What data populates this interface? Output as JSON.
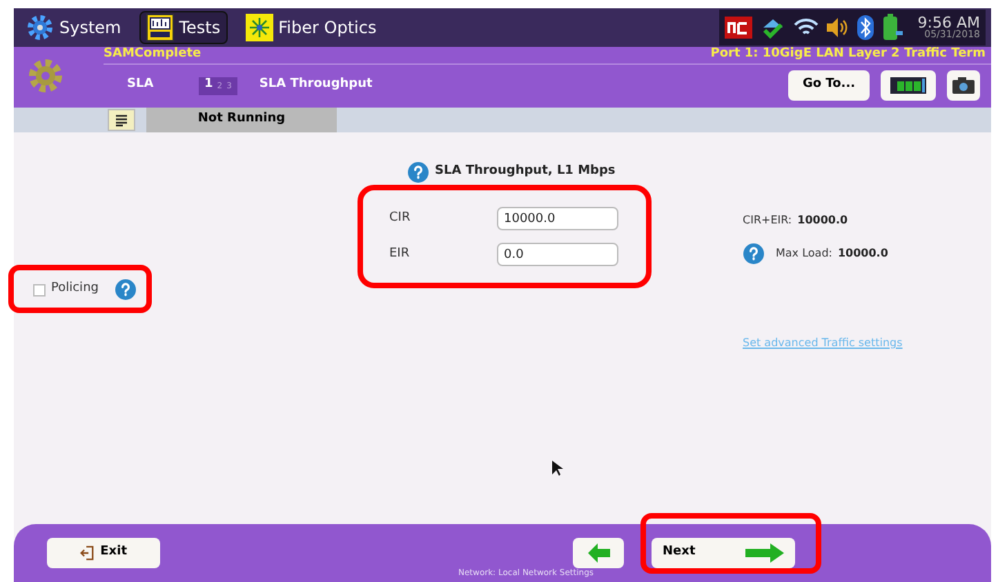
{
  "top_bar": {
    "tabs": [
      {
        "label": "System",
        "selected": false
      },
      {
        "label": "Tests",
        "selected": true
      },
      {
        "label": "Fiber Optics",
        "selected": false
      }
    ],
    "time": "9:56 AM",
    "date": "05/31/2018"
  },
  "header": {
    "test_name": "SAMComplete",
    "port": "Port 1: 10GigE LAN Layer 2 Traffic Term",
    "section": "SLA",
    "steps": [
      {
        "label": "1",
        "selected": true
      },
      {
        "label": "2",
        "selected": false
      },
      {
        "label": "3",
        "selected": false
      }
    ],
    "step_title": "SLA Throughput",
    "goto": "Go To...",
    "status": "Not Running"
  },
  "form": {
    "title": "SLA Throughput, L1 Mbps",
    "fields": [
      {
        "label": "CIR",
        "value": "10000.0"
      },
      {
        "label": "EIR",
        "value": "0.0"
      }
    ],
    "cir_eir_label": "CIR+EIR:",
    "cir_eir_value": "10000.0",
    "max_load_label": "Max Load:",
    "max_load_value": "10000.0",
    "policing": {
      "label": "Policing",
      "checked": false
    },
    "link": "Set advanced Traffic settings"
  },
  "footer": {
    "exit": "Exit",
    "next": "Next",
    "prev_hint": "Network: Local Network Settings"
  }
}
